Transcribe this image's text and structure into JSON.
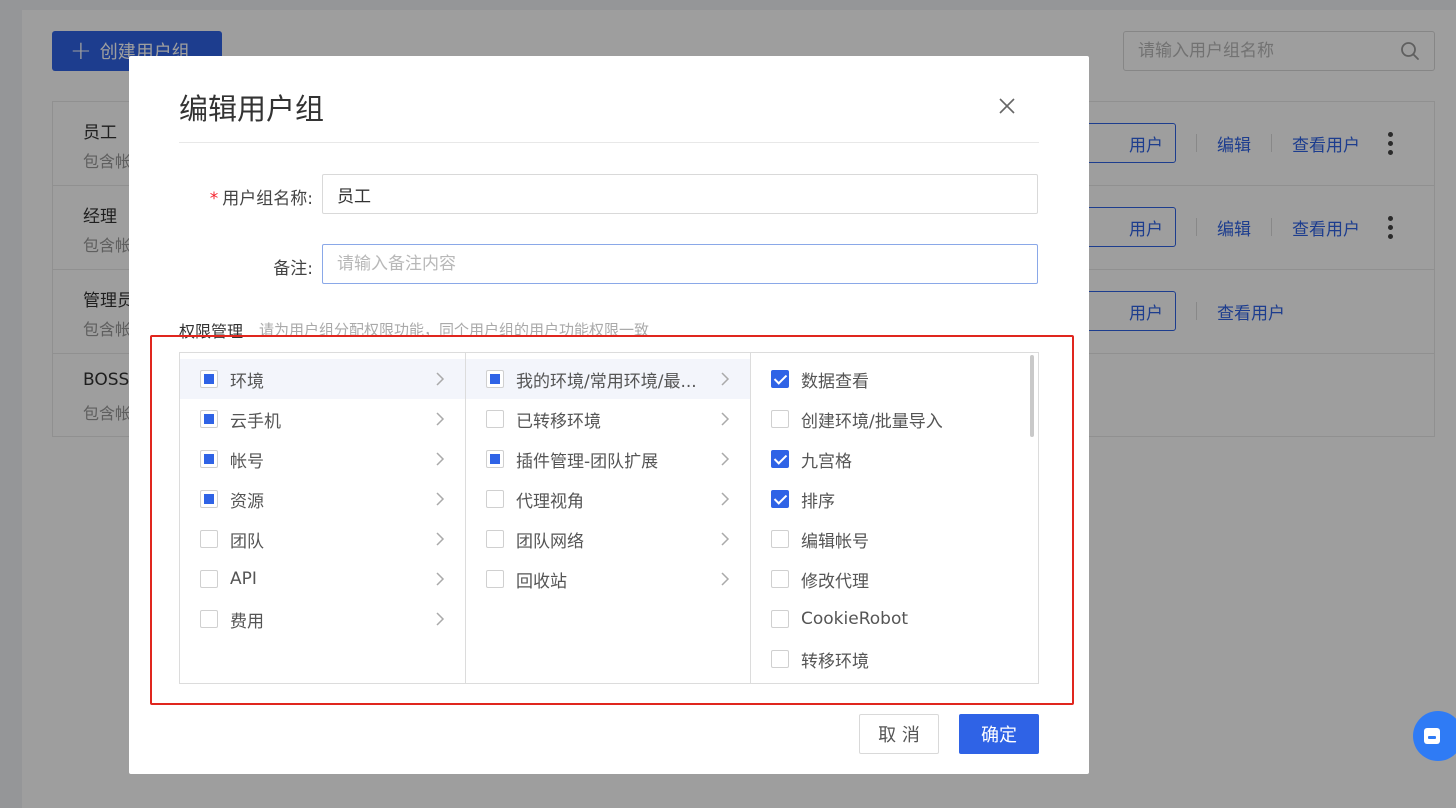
{
  "toolbar": {
    "create_label": "创建用户组",
    "search_placeholder": "请输入用户组名称"
  },
  "groups": [
    {
      "name": "员工",
      "sub": "包含帐",
      "btn": "用户",
      "edit": "编辑",
      "view": "查看用户"
    },
    {
      "name": "经理",
      "sub": "包含帐",
      "btn": "用户",
      "edit": "编辑",
      "view": "查看用户"
    },
    {
      "name": "管理员",
      "sub": "包含帐",
      "btn": "用户",
      "view": "查看用户"
    },
    {
      "name": "BOSS",
      "sub": "包含帐"
    }
  ],
  "modal": {
    "title": "编辑用户组",
    "name_required": "*",
    "name_label": "用户组名称:",
    "name_value": "员工",
    "remark_label": "备注:",
    "remark_placeholder": "请输入备注内容",
    "perm_title": "权限管理",
    "perm_hint": "请为用户组分配权限功能，同个用户组的用户功能权限一致",
    "cancel_label": "取 消",
    "ok_label": "确定"
  },
  "perm_col1": [
    {
      "label": "环境",
      "state": "partial",
      "active": true
    },
    {
      "label": "云手机",
      "state": "partial"
    },
    {
      "label": "帐号",
      "state": "partial"
    },
    {
      "label": "资源",
      "state": "partial"
    },
    {
      "label": "团队",
      "state": "unchecked"
    },
    {
      "label": "API",
      "state": "unchecked"
    },
    {
      "label": "费用",
      "state": "unchecked"
    }
  ],
  "perm_col2": [
    {
      "label": "我的环境/常用环境/最...",
      "state": "partial",
      "active": true
    },
    {
      "label": "已转移环境",
      "state": "unchecked"
    },
    {
      "label": "插件管理-团队扩展",
      "state": "partial"
    },
    {
      "label": "代理视角",
      "state": "unchecked"
    },
    {
      "label": "团队网络",
      "state": "unchecked"
    },
    {
      "label": "回收站",
      "state": "unchecked"
    }
  ],
  "perm_col3": [
    {
      "label": "数据查看",
      "state": "checked"
    },
    {
      "label": "创建环境/批量导入",
      "state": "unchecked"
    },
    {
      "label": "九宫格",
      "state": "checked"
    },
    {
      "label": "排序",
      "state": "checked"
    },
    {
      "label": "编辑帐号",
      "state": "unchecked"
    },
    {
      "label": "修改代理",
      "state": "unchecked"
    },
    {
      "label": "CookieRobot",
      "state": "unchecked"
    },
    {
      "label": "转移环境",
      "state": "unchecked"
    }
  ],
  "colors": {
    "primary": "#2f63e6",
    "highlight_border": "#e0261e",
    "required": "#f5222d"
  }
}
